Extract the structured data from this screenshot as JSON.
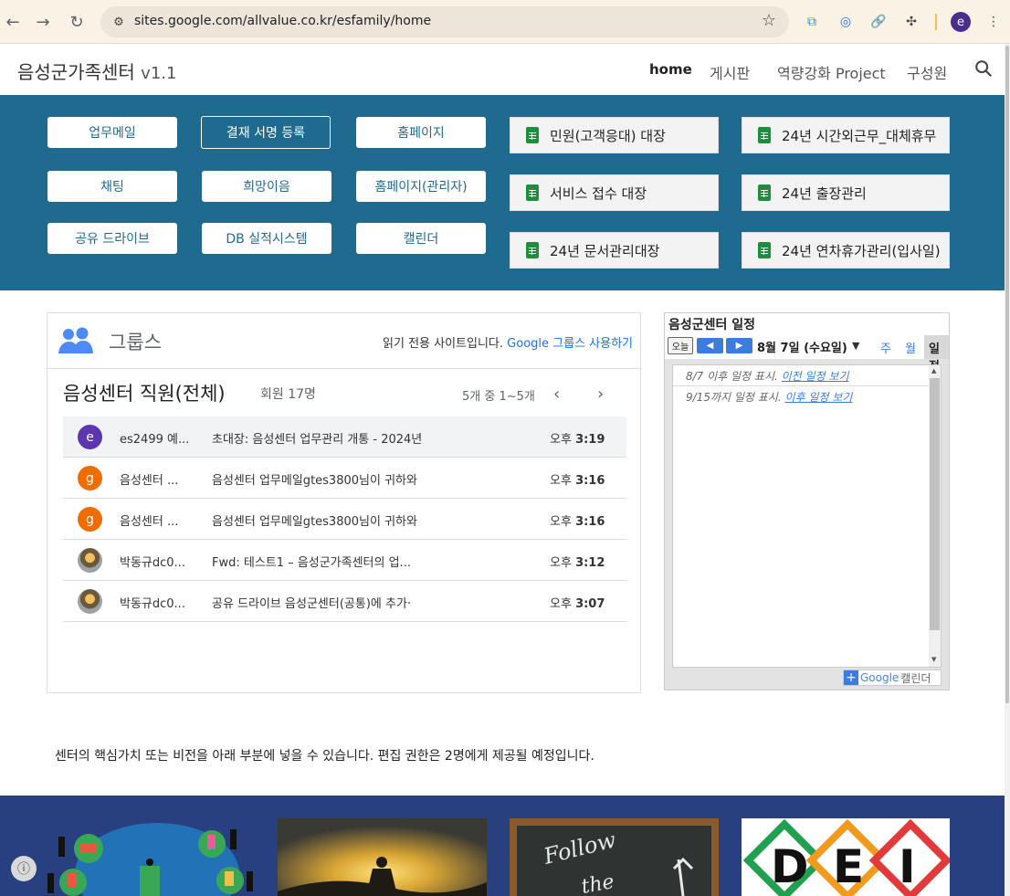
{
  "browser": {
    "url": "sites.google.com/allvalue.co.kr/esfamily/home",
    "profile_initial": "e"
  },
  "header": {
    "site_title": "음성군가족센터",
    "version": "v1.1",
    "nav": [
      "home",
      "게시판",
      "역량강화 Project",
      "구성원"
    ]
  },
  "quick_links": {
    "buttons": [
      "업무메일",
      "결재 서명 등록",
      "홈페이지",
      "채팅",
      "희망이음",
      "홈페이지(관리자)",
      "공유 드라이브",
      "DB 실적시스템",
      "캘린더"
    ],
    "sheets": [
      "민원(고객응대) 대장",
      "24년 시간외근무_대체휴무",
      "서비스 접수 대장",
      "24년 출장관리",
      "24년 문서관리대장",
      "24년 연차휴가관리(입사일)"
    ]
  },
  "groups": {
    "title": "그룹스",
    "readonly_prefix": "읽기 전용 사이트입니다.",
    "readonly_link": "Google 그룹스 사용하기",
    "group_name": "음성센터 직원(전체)",
    "members": "회원 17명",
    "range": "5개 중 1~5개",
    "rows": [
      {
        "avatar": "e",
        "from": "es2499 예...",
        "subject": "초대장: 음성센터 업무관리 개통 - 2024년",
        "time_prefix": "오후",
        "time": "3:19"
      },
      {
        "avatar": "g",
        "from": "음성센터 ...",
        "subject": "음성센터 업무메일gtes3800님이 귀하와",
        "time_prefix": "오후",
        "time": "3:16"
      },
      {
        "avatar": "g",
        "from": "음성센터 ...",
        "subject": "음성센터 업무메일gtes3800님이 귀하와",
        "time_prefix": "오후",
        "time": "3:16"
      },
      {
        "avatar": "",
        "from": "박동규dc0...",
        "subject": "Fwd: 테스트1 – 음성군가족센터의 업...",
        "time_prefix": "오후",
        "time": "3:12"
      },
      {
        "avatar": "",
        "from": "박동규dc0...",
        "subject": "공유 드라이브 음성군센터(공통)에 추가·",
        "time_prefix": "오후",
        "time": "3:07"
      }
    ]
  },
  "calendar": {
    "title": "음성군센터 일정",
    "today": "오늘",
    "date": "8월 7일 (수요일)",
    "tabs": [
      "주",
      "월",
      "일정"
    ],
    "line1_text": "8/7 이후 일정 표시.",
    "line1_link": "이전 일정 보기",
    "line2_text": "9/15까지 일정 표시.",
    "line2_link": "이후 일정 보기",
    "footer_google": "Google",
    "footer_label": "캘린더"
  },
  "vision_text": "센터의 핵심가치 또는 비전을 아래 부분에 넣을 수 있습니다. 편집 권한은 2명에게 제공될 예정입니다.",
  "footer_images": {
    "dei_letters": [
      "D",
      "E",
      "I"
    ],
    "follow_text": "Follow the"
  },
  "colors": {
    "band": "#1f6a8f",
    "accent": "#1a73e8",
    "footer": "#283f80"
  }
}
